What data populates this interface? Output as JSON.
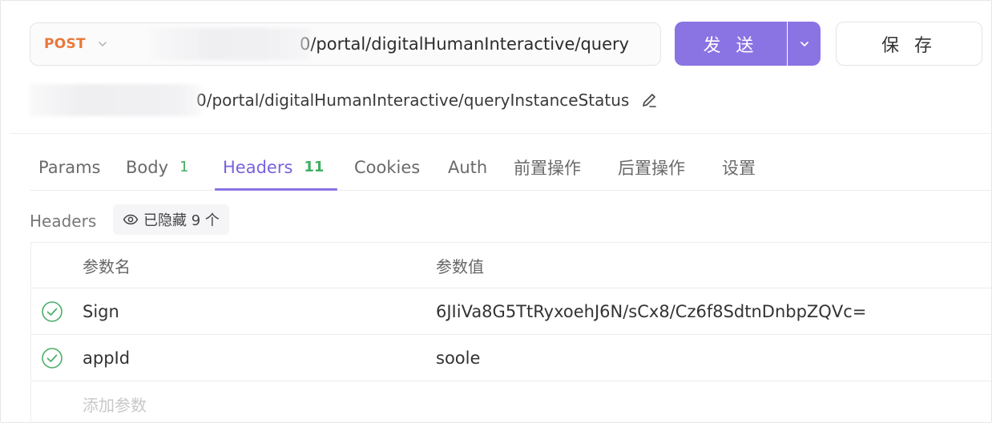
{
  "request": {
    "method": "POST",
    "url_visible": "0/portal/digitalHumanInteractive/query",
    "resolved_url_visible": "0/portal/digitalHumanInteractive/queryInstanceStatus",
    "send_label": "发 送",
    "save_label": "保 存"
  },
  "tabs": [
    {
      "label": "Params",
      "count": ""
    },
    {
      "label": "Body",
      "count": "1"
    },
    {
      "label": "Headers",
      "count": "11",
      "active": true
    },
    {
      "label": "Cookies",
      "count": ""
    },
    {
      "label": "Auth",
      "count": ""
    },
    {
      "label": "前置操作",
      "count": ""
    },
    {
      "label": "后置操作",
      "count": ""
    },
    {
      "label": "设置",
      "count": ""
    }
  ],
  "headers_section": {
    "title": "Headers",
    "hidden_label": "已隐藏 9 个"
  },
  "table": {
    "col_name": "参数名",
    "col_value": "参数值",
    "rows": [
      {
        "name": "Sign",
        "value": "6JIiVa8G5TtRyxoehJ6N/sCx8/Cz6f8SdtnDnbpZQVc=",
        "enabled": true
      },
      {
        "name": "appId",
        "value": "soole",
        "enabled": true
      }
    ],
    "add_placeholder": "添加参数"
  },
  "colors": {
    "accent": "#8a73e3",
    "method_post": "#e8783a",
    "count_green": "#3fae5f",
    "check_green": "#4caf6a"
  },
  "icons": [
    "chevron-down-icon",
    "edit-pencil-icon",
    "eye-icon",
    "check-circle-icon"
  ]
}
